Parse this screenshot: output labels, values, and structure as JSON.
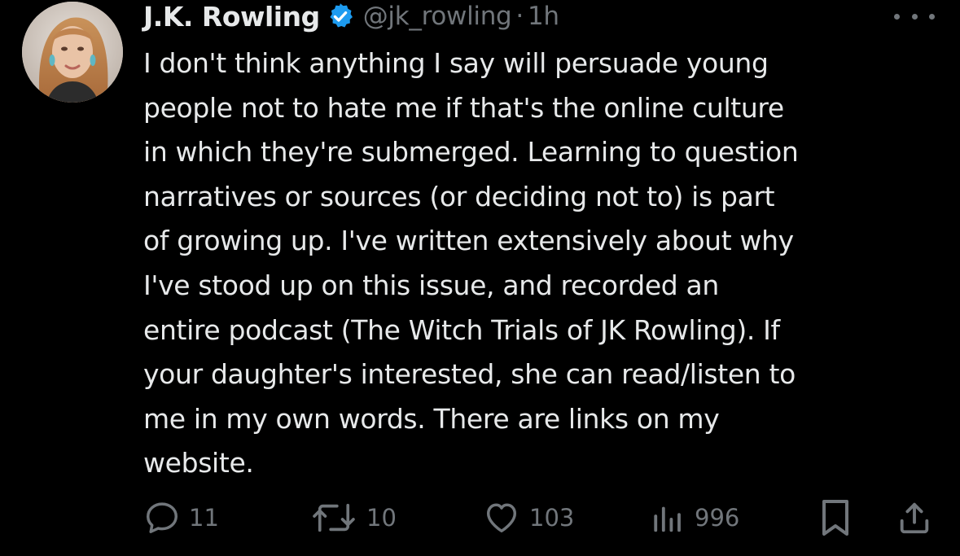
{
  "author": {
    "display_name": "J.K. Rowling",
    "handle": "@jk_rowling",
    "separator": "·",
    "time": "1h",
    "verified_color": "#1d9bf0"
  },
  "tweet": {
    "text": "I don't think anything I say will persuade young\npeople not to hate me if that's the online culture\nin which they're submerged. Learning to question\nnarratives or sources (or deciding not to) is part\nof growing up. I've written extensively about why\nI've stood up on this issue, and recorded an\nentire podcast (The Witch Trials of JK Rowling). If\nyour daughter's interested, she can read/listen to\nme in my own words. There are links on my\nwebsite."
  },
  "actions": {
    "replies": "11",
    "reposts": "10",
    "likes": "103",
    "views": "996",
    "icons": [
      "reply-icon",
      "repost-icon",
      "like-icon",
      "views-icon",
      "bookmark-icon",
      "share-icon"
    ]
  },
  "colors": {
    "background": "#000000",
    "text": "#e7e9ea",
    "secondary": "#71767b",
    "accent": "#1d9bf0"
  }
}
